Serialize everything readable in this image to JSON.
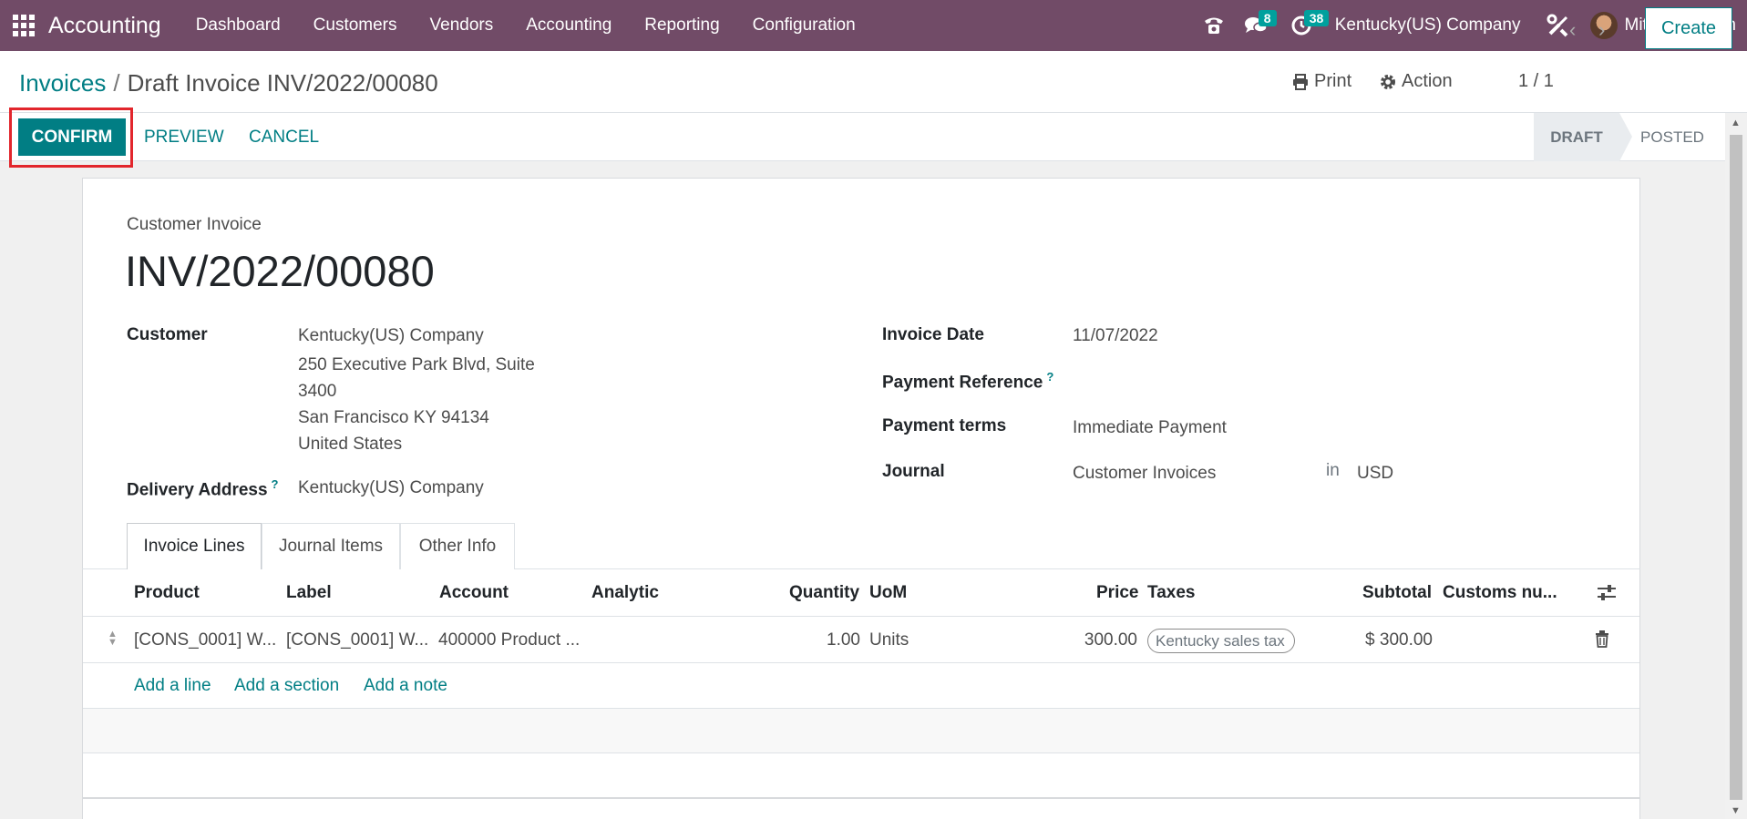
{
  "nav": {
    "app_name": "Accounting",
    "menu": [
      "Dashboard",
      "Customers",
      "Vendors",
      "Accounting",
      "Reporting",
      "Configuration"
    ],
    "messages_count": "8",
    "activities_count": "38",
    "company": "Kentucky(US) Company",
    "user": "Mitchell Admin"
  },
  "control": {
    "breadcrumb_parent": "Invoices",
    "breadcrumb_separator": "/",
    "breadcrumb_current": "Draft Invoice INV/2022/00080",
    "print_label": "Print",
    "action_label": "Action",
    "pager": "1 / 1",
    "create_label": "Create"
  },
  "statusbar": {
    "confirm_label": "CONFIRM",
    "preview_label": "PREVIEW",
    "cancel_label": "CANCEL",
    "stages": [
      "DRAFT",
      "POSTED"
    ],
    "current_stage": "DRAFT"
  },
  "form": {
    "type_label": "Customer Invoice",
    "name": "INV/2022/00080",
    "customer_label": "Customer",
    "customer_name": "Kentucky(US) Company",
    "address_line1": "250 Executive Park Blvd, Suite",
    "address_line2": "3400",
    "address_line3": "San Francisco KY 94134",
    "address_line4": "United States",
    "delivery_label": "Delivery Address",
    "delivery_value": "Kentucky(US) Company",
    "invoice_date_label": "Invoice Date",
    "invoice_date": "11/07/2022",
    "payment_ref_label": "Payment Reference",
    "payment_terms_label": "Payment terms",
    "payment_terms": "Immediate Payment",
    "journal_label": "Journal",
    "journal": "Customer Invoices",
    "in_label": "in",
    "currency": "USD",
    "help_mark": "?"
  },
  "tabs": [
    "Invoice Lines",
    "Journal Items",
    "Other Info"
  ],
  "table": {
    "headers": {
      "product": "Product",
      "label": "Label",
      "account": "Account",
      "analytic": "Analytic",
      "quantity": "Quantity",
      "uom": "UoM",
      "price": "Price",
      "taxes": "Taxes",
      "subtotal": "Subtotal",
      "customs": "Customs nu..."
    },
    "rows": [
      {
        "product": "[CONS_0001] W...",
        "label": "[CONS_0001] W...",
        "account": "400000 Product ...",
        "analytic": "",
        "quantity": "1.00",
        "uom": "Units",
        "price": "300.00",
        "taxes": "Kentucky sales tax",
        "subtotal": "$ 300.00"
      }
    ],
    "add_line": "Add a line",
    "add_section": "Add a section",
    "add_note": "Add a note"
  }
}
